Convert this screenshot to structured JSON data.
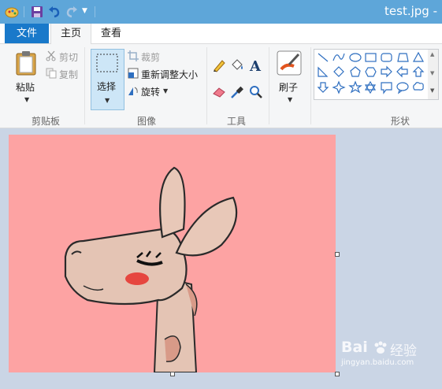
{
  "window": {
    "title": "test.jpg -"
  },
  "tabs": {
    "file": "文件",
    "home": "主页",
    "view": "查看"
  },
  "clipboard": {
    "paste": "粘贴",
    "cut": "剪切",
    "copy": "复制",
    "group": "剪贴板"
  },
  "image": {
    "select": "选择",
    "crop": "裁剪",
    "resize": "重新调整大小",
    "rotate": "旋转",
    "group": "图像"
  },
  "tools": {
    "group": "工具",
    "text_glyph": "A"
  },
  "brushes": {
    "label": "刷子"
  },
  "shapes": {
    "group": "形状"
  },
  "watermark": {
    "brand": "Bai",
    "brand2": "经验",
    "url": "jingyan.baidu.com"
  },
  "colors": {
    "titlebar": "#5ea6d9",
    "file_tab": "#1979ca",
    "canvas_bg": "#fda3a3",
    "select_active": "#cde6f7"
  }
}
